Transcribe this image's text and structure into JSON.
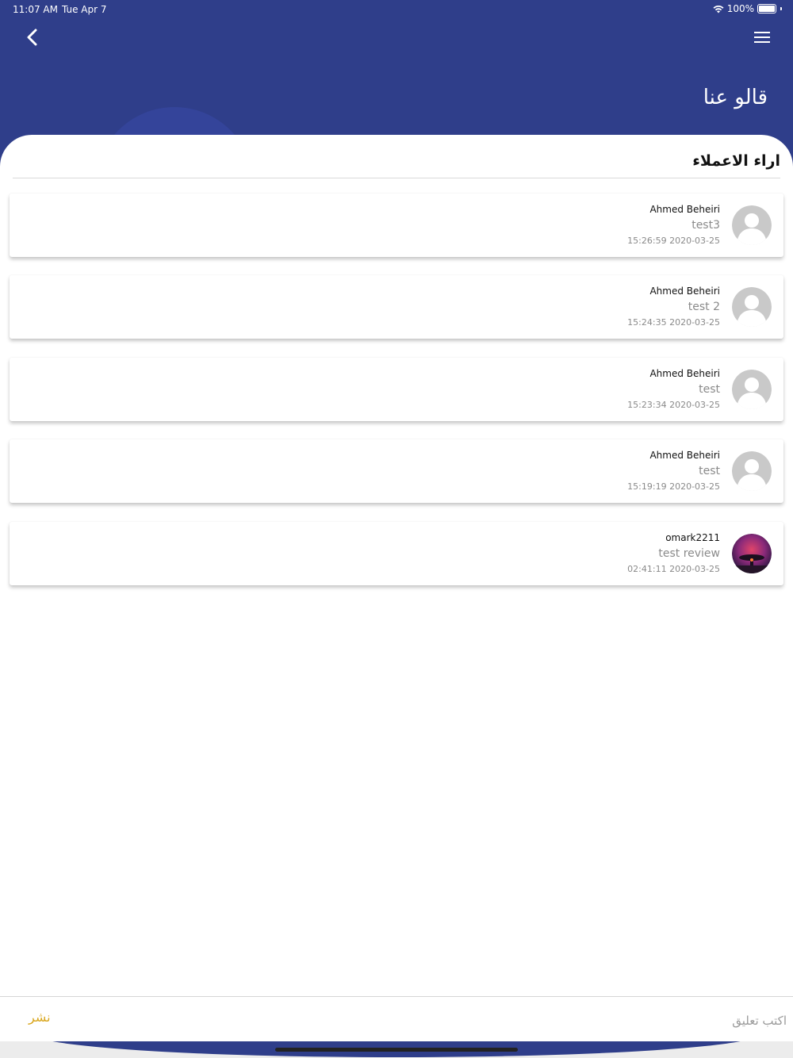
{
  "status_bar": {
    "time": "11:07 AM",
    "date": "Tue Apr 7",
    "battery": "100%",
    "wifi_icon": "wifi-icon",
    "battery_icon": "battery-icon"
  },
  "header": {
    "title": "قالو عنا",
    "back_icon": "chevron-left-icon",
    "menu_icon": "hamburger-menu-icon"
  },
  "section": {
    "title": "اراء الاعملاء"
  },
  "reviews": [
    {
      "name": "Ahmed Beheiri",
      "text": "test3",
      "datetime": "15:26:59 2020-03-25",
      "avatar": "default-user-avatar"
    },
    {
      "name": "Ahmed Beheiri",
      "text": "test 2",
      "datetime": "15:24:35 2020-03-25",
      "avatar": "default-user-avatar"
    },
    {
      "name": "Ahmed Beheiri",
      "text": "test",
      "datetime": "15:23:34 2020-03-25",
      "avatar": "default-user-avatar"
    },
    {
      "name": "Ahmed Beheiri",
      "text": "test",
      "datetime": "15:19:19 2020-03-25",
      "avatar": "default-user-avatar"
    },
    {
      "name": "omark2211",
      "text": "test review",
      "datetime": "02:41:11 2020-03-25",
      "avatar": "photo-avatar"
    }
  ],
  "composer": {
    "placeholder": "اكتب تعليق",
    "publish_label": "نشر"
  },
  "colors": {
    "header_bg": "#2f3e8a",
    "accent": "#d9a61c"
  }
}
